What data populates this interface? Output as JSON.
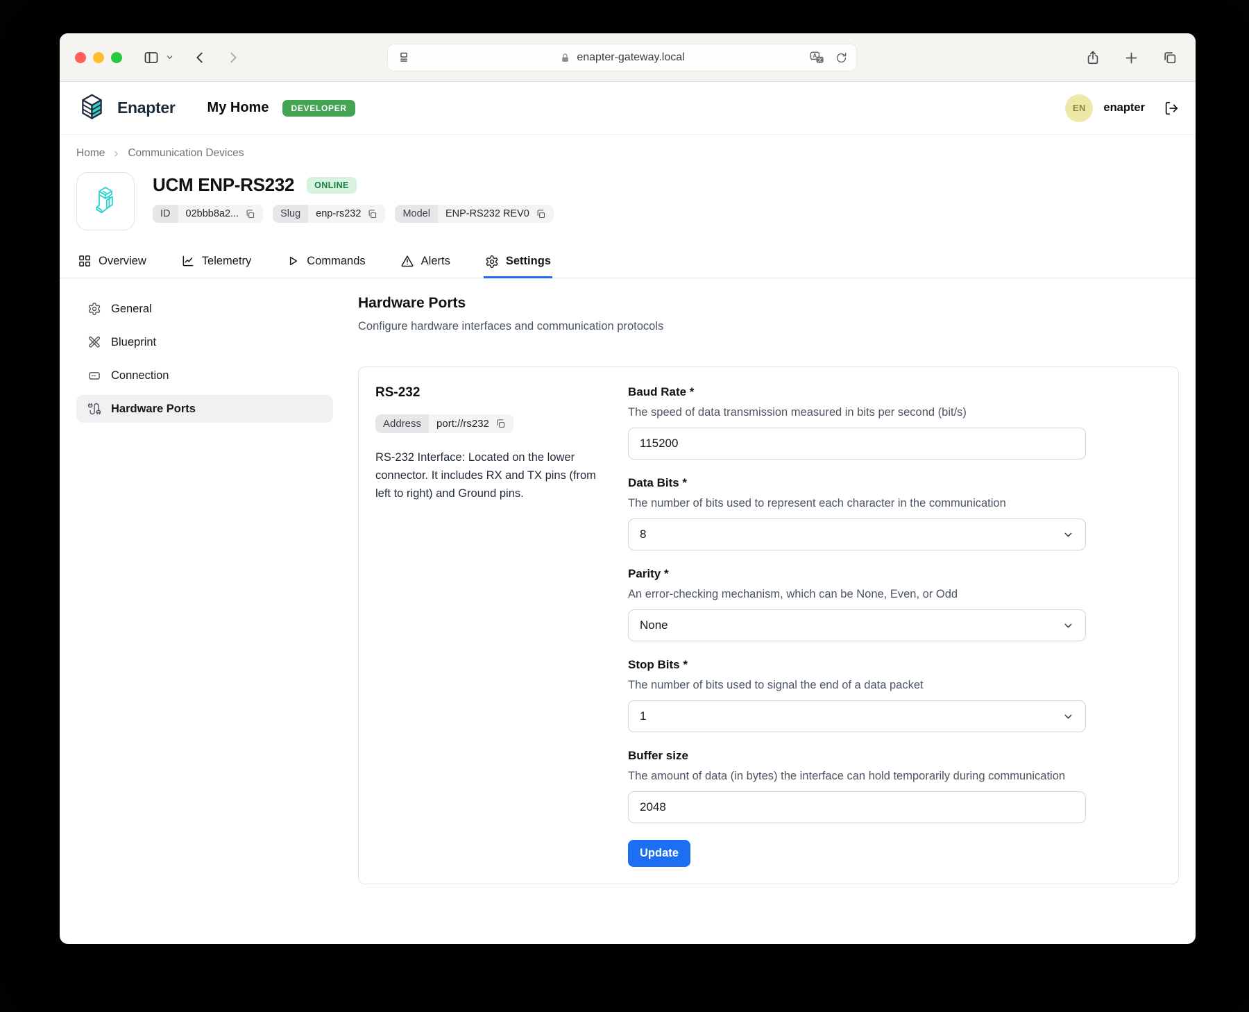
{
  "browser": {
    "url_host": "enapter-gateway.local"
  },
  "header": {
    "brand": "Enapter",
    "site": "My Home",
    "badge": "DEVELOPER",
    "user_initials": "EN",
    "username": "enapter"
  },
  "breadcrumb": {
    "items": [
      "Home",
      "Communication Devices"
    ]
  },
  "device": {
    "title": "UCM ENP-RS232",
    "status": "ONLINE",
    "chips": [
      {
        "label": "ID",
        "value": "02bbb8a2..."
      },
      {
        "label": "Slug",
        "value": "enp-rs232"
      },
      {
        "label": "Model",
        "value": "ENP-RS232 REV0"
      }
    ]
  },
  "tabs": {
    "items": [
      {
        "label": "Overview",
        "icon": "grid-icon",
        "active": false
      },
      {
        "label": "Telemetry",
        "icon": "chart-icon",
        "active": false
      },
      {
        "label": "Commands",
        "icon": "play-icon",
        "active": false
      },
      {
        "label": "Alerts",
        "icon": "alert-triangle-icon",
        "active": false
      },
      {
        "label": "Settings",
        "icon": "gear-icon",
        "active": true
      }
    ]
  },
  "sidebar": {
    "items": [
      {
        "label": "General",
        "icon": "gear-icon",
        "active": false
      },
      {
        "label": "Blueprint",
        "icon": "blueprint-icon",
        "active": false
      },
      {
        "label": "Connection",
        "icon": "ethernet-icon",
        "active": false
      },
      {
        "label": "Hardware Ports",
        "icon": "cable-icon",
        "active": true
      }
    ]
  },
  "page": {
    "title": "Hardware Ports",
    "subtitle": "Configure hardware interfaces and communication protocols"
  },
  "card": {
    "title": "RS-232",
    "address_label": "Address",
    "address_value": "port://rs232",
    "description": "RS-232 Interface: Located on the lower connector. It includes RX and TX pins (from left to right) and Ground pins.",
    "fields": [
      {
        "label": "Baud Rate *",
        "description": "The speed of data transmission measured in bits per second (bit/s)",
        "value": "115200",
        "type": "input"
      },
      {
        "label": "Data Bits *",
        "description": "The number of bits used to represent each character in the communication",
        "value": "8",
        "type": "select"
      },
      {
        "label": "Parity *",
        "description": "An error-checking mechanism, which can be None, Even, or Odd",
        "value": "None",
        "type": "select"
      },
      {
        "label": "Stop Bits *",
        "description": "The number of bits used to signal the end of a data packet",
        "value": "1",
        "type": "select"
      },
      {
        "label": "Buffer size",
        "description": "The amount of data (in bytes) the interface can hold temporarily during communication",
        "value": "2048",
        "type": "input"
      }
    ],
    "update_label": "Update"
  },
  "colors": {
    "accent_blue": "#1c6ff2",
    "tab_underline_blue": "#2268f0",
    "developer_badge_green": "#43a554",
    "online_badge_bg": "#d8f2e2",
    "online_badge_text": "#177f3f",
    "device_teal": "#2ed3cc",
    "toolbar_bg": "#f5f4f0"
  }
}
